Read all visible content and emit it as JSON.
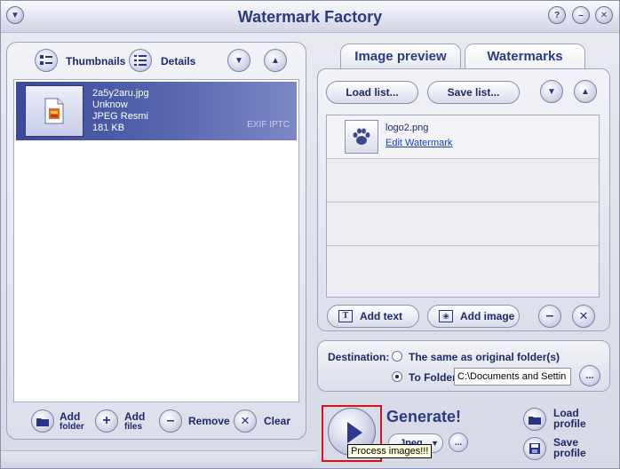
{
  "app": {
    "title": "Watermark Factory"
  },
  "left_panel": {
    "view_thumbnails": "Thumbnails",
    "view_details": "Details",
    "files": [
      {
        "name": "2a5y2aru.jpg",
        "line2": "Unknow",
        "line3": "JPEG Resmi",
        "size": "181 KB",
        "tags": "EXIF  IPTC"
      }
    ],
    "add_folder": [
      "Add",
      "folder"
    ],
    "add_files": [
      "Add",
      "files"
    ],
    "remove": "Remove",
    "clear": "Clear"
  },
  "tabs": {
    "image_preview": "Image preview",
    "watermarks": "Watermarks"
  },
  "watermarks": {
    "load_list": "Load list...",
    "save_list": "Save list...",
    "items": [
      {
        "name": "logo2.png",
        "link": "Edit Watermark"
      }
    ],
    "add_text": "Add text",
    "add_image": "Add image"
  },
  "destination": {
    "label": "Destination:",
    "option_same": "The same as original folder(s)",
    "option_folder": "To Folder",
    "folder_value": "C:\\Documents and Settin",
    "browse": "..."
  },
  "generate": {
    "label": "Generate!",
    "format": "Jpeg",
    "tooltip": "Process images!!!",
    "more": "...",
    "load_profile": [
      "Load",
      "profile"
    ],
    "save_profile": [
      "Save",
      "profile"
    ]
  }
}
